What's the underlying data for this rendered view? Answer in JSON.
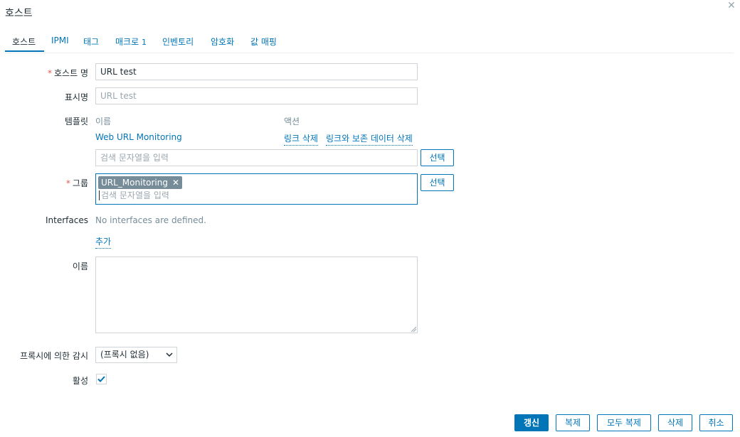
{
  "dialog": {
    "title": "호스트",
    "close_icon": "close-icon"
  },
  "tabs": [
    {
      "label": "호스트",
      "active": true
    },
    {
      "label": "IPMI"
    },
    {
      "label": "태그"
    },
    {
      "label": "매크로",
      "badge": "1"
    },
    {
      "label": "인벤토리"
    },
    {
      "label": "암호화"
    },
    {
      "label": "값 매핑"
    }
  ],
  "form": {
    "required_mark": "*",
    "host_name": {
      "label": "호스트 명",
      "value": "URL test"
    },
    "visible_name": {
      "label": "표시명",
      "placeholder": "URL test"
    },
    "templates": {
      "label": "템플릿",
      "col_name": "이름",
      "col_action": "액션",
      "rows": [
        {
          "name": "Web URL Monitoring",
          "unlink": "링크 삭제",
          "unlink_clear": "링크와 보존 데이터 삭제"
        }
      ],
      "search_placeholder": "검색 문자열을 입력",
      "select_button": "선택"
    },
    "groups": {
      "label": "그룹",
      "chips": [
        "URL_Monitoring"
      ],
      "chip_remove": "✕",
      "search_placeholder": "검색 문자열을 입력",
      "select_button": "선택"
    },
    "interfaces": {
      "label": "Interfaces",
      "empty_text": "No interfaces are defined.",
      "add_link": "추가"
    },
    "description": {
      "label": "이름",
      "value": ""
    },
    "proxy": {
      "label": "프록시에 의한 감시",
      "selected": "(프록시 없음)"
    },
    "enabled": {
      "label": "활성",
      "checked": true
    }
  },
  "footer": {
    "update": "갱신",
    "clone": "복제",
    "full_clone": "모두 복제",
    "delete": "삭제",
    "cancel": "취소"
  },
  "colors": {
    "accent": "#0275b8",
    "required": "#e45959",
    "chip_bg": "#768d99"
  }
}
